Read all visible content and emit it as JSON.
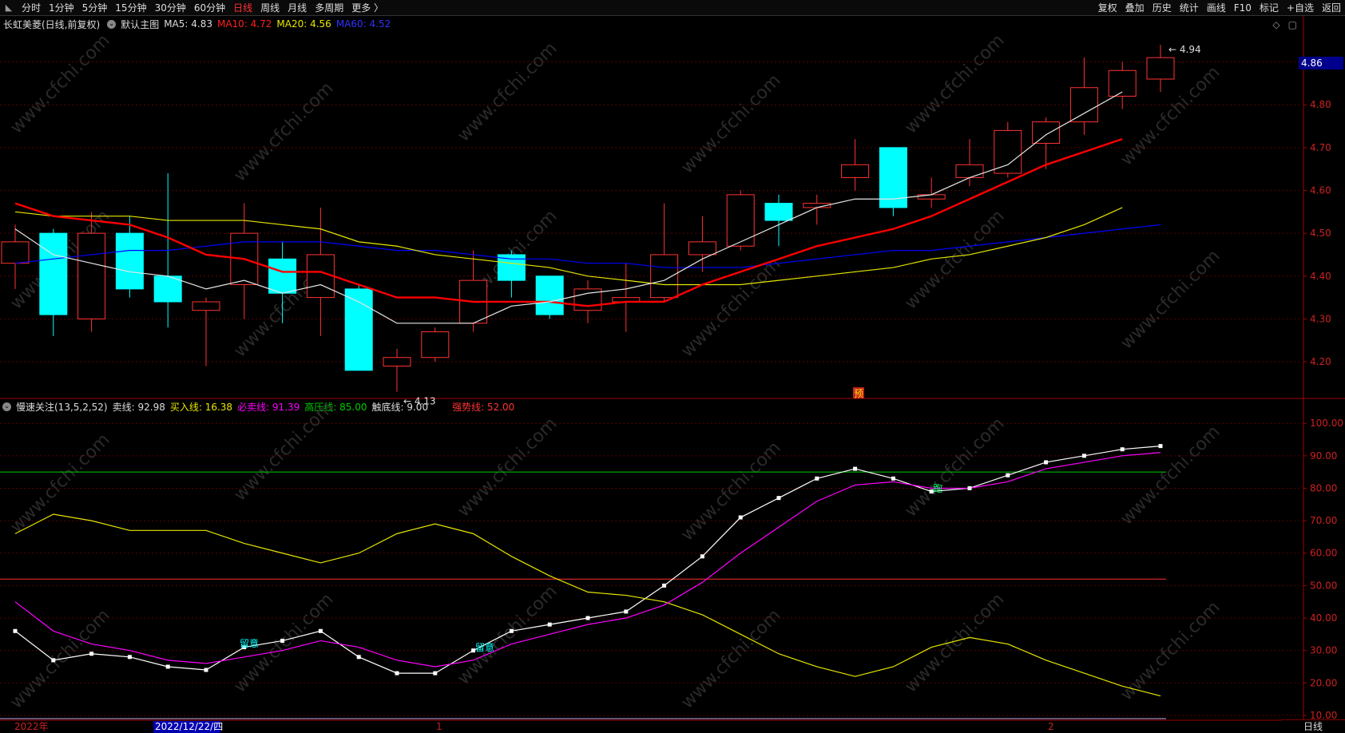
{
  "toolbar": {
    "left_items": [
      {
        "label": "分时",
        "active": false
      },
      {
        "label": "1分钟",
        "active": false
      },
      {
        "label": "5分钟",
        "active": false
      },
      {
        "label": "15分钟",
        "active": false
      },
      {
        "label": "30分钟",
        "active": false
      },
      {
        "label": "60分钟",
        "active": false
      },
      {
        "label": "日线",
        "active": true
      },
      {
        "label": "周线",
        "active": false
      },
      {
        "label": "月线",
        "active": false
      },
      {
        "label": "多周期",
        "active": false
      },
      {
        "label": "更多 〉",
        "active": false
      }
    ],
    "right_items": [
      "复权",
      "叠加",
      "历史",
      "统计",
      "画线",
      "F10",
      "标记",
      "+自选",
      "返回"
    ]
  },
  "main_info": {
    "stock_name": "长虹美菱(日线,前复权)",
    "template": "默认主图",
    "ma5": "MA5: 4.83",
    "ma10": "MA10: 4.72",
    "ma20": "MA20: 4.56",
    "ma60": "MA60: 4.52"
  },
  "indicator_info": {
    "name": "慢速关注(13,5,2,52)",
    "sell": "卖线: 92.98",
    "buy": "买入线: 16.38",
    "must_sell": "必卖线: 91.39",
    "high": "高压线: 85.00",
    "bottom": "触底线: 9.00",
    "strong": "强势线: 52.00"
  },
  "current_price": "4.86",
  "annotations": {
    "high_label": "4.94",
    "low_label": "4.13",
    "main_tag": "预",
    "ind_tags": [
      "留意",
      "留意",
      "跑"
    ]
  },
  "x_axis": {
    "labels": [
      "2022年",
      "2022/12/22/四",
      "1",
      "2"
    ]
  },
  "corner_label": "日线",
  "watermark": "www.cfchi.com",
  "colors": {
    "up": "#ff3232",
    "down": "#00ffff",
    "ma5": "#e6e6e6",
    "ma10": "#ff0000",
    "ma20": "#e6e600",
    "ma60": "#0000ff",
    "sell_line": "#ffffff",
    "buy_line": "#e6e600",
    "must_sell": "#ff00ff",
    "high_line": "#00cc00",
    "strong_line": "#ff3333",
    "axis": "#a00000"
  },
  "chart_data": [
    {
      "type": "candlestick",
      "title": "长虹美菱(日线,前复权)",
      "y_ticks": [
        4.2,
        4.3,
        4.4,
        4.5,
        4.6,
        4.7,
        4.8,
        4.9
      ],
      "ylim": [
        4.12,
        4.97
      ],
      "candles": [
        {
          "o": 4.43,
          "h": 4.52,
          "l": 4.37,
          "c": 4.48
        },
        {
          "o": 4.5,
          "h": 4.51,
          "l": 4.26,
          "c": 4.31
        },
        {
          "o": 4.3,
          "h": 4.55,
          "l": 4.27,
          "c": 4.5
        },
        {
          "o": 4.5,
          "h": 4.54,
          "l": 4.35,
          "c": 4.37
        },
        {
          "o": 4.4,
          "h": 4.64,
          "l": 4.28,
          "c": 4.34
        },
        {
          "o": 4.32,
          "h": 4.35,
          "l": 4.19,
          "c": 4.34
        },
        {
          "o": 4.38,
          "h": 4.57,
          "l": 4.3,
          "c": 4.5
        },
        {
          "o": 4.44,
          "h": 4.48,
          "l": 4.29,
          "c": 4.36
        },
        {
          "o": 4.35,
          "h": 4.56,
          "l": 4.26,
          "c": 4.45
        },
        {
          "o": 4.37,
          "h": 4.38,
          "l": 4.18,
          "c": 4.18
        },
        {
          "o": 4.19,
          "h": 4.23,
          "l": 4.13,
          "c": 4.21
        },
        {
          "o": 4.21,
          "h": 4.28,
          "l": 4.2,
          "c": 4.27
        },
        {
          "o": 4.29,
          "h": 4.46,
          "l": 4.27,
          "c": 4.39
        },
        {
          "o": 4.45,
          "h": 4.46,
          "l": 4.35,
          "c": 4.39
        },
        {
          "o": 4.4,
          "h": 4.4,
          "l": 4.3,
          "c": 4.31
        },
        {
          "o": 4.32,
          "h": 4.39,
          "l": 4.29,
          "c": 4.37
        },
        {
          "o": 4.34,
          "h": 4.43,
          "l": 4.27,
          "c": 4.35
        },
        {
          "o": 4.35,
          "h": 4.57,
          "l": 4.34,
          "c": 4.45
        },
        {
          "o": 4.45,
          "h": 4.54,
          "l": 4.41,
          "c": 4.48
        },
        {
          "o": 4.47,
          "h": 4.6,
          "l": 4.46,
          "c": 4.59
        },
        {
          "o": 4.57,
          "h": 4.59,
          "l": 4.47,
          "c": 4.53
        },
        {
          "o": 4.56,
          "h": 4.59,
          "l": 4.52,
          "c": 4.57
        },
        {
          "o": 4.63,
          "h": 4.72,
          "l": 4.6,
          "c": 4.66
        },
        {
          "o": 4.7,
          "h": 4.7,
          "l": 4.54,
          "c": 4.56
        },
        {
          "o": 4.58,
          "h": 4.63,
          "l": 4.56,
          "c": 4.59
        },
        {
          "o": 4.63,
          "h": 4.72,
          "l": 4.61,
          "c": 4.66
        },
        {
          "o": 4.64,
          "h": 4.76,
          "l": 4.63,
          "c": 4.74
        },
        {
          "o": 4.71,
          "h": 4.77,
          "l": 4.65,
          "c": 4.76
        },
        {
          "o": 4.76,
          "h": 4.91,
          "l": 4.73,
          "c": 4.84
        },
        {
          "o": 4.82,
          "h": 4.9,
          "l": 4.79,
          "c": 4.88
        },
        {
          "o": 4.86,
          "h": 4.94,
          "l": 4.83,
          "c": 4.91
        }
      ],
      "ma5": [
        4.51,
        4.45,
        4.43,
        4.41,
        4.4,
        4.37,
        4.39,
        4.36,
        4.38,
        4.34,
        4.29,
        4.29,
        4.29,
        4.33,
        4.34,
        4.36,
        4.37,
        4.39,
        4.44,
        4.48,
        4.52,
        4.56,
        4.58,
        4.58,
        4.59,
        4.63,
        4.66,
        4.73,
        4.78,
        4.83
      ],
      "ma10": [
        4.57,
        4.54,
        4.53,
        4.52,
        4.49,
        4.45,
        4.44,
        4.41,
        4.41,
        4.38,
        4.35,
        4.35,
        4.34,
        4.34,
        4.34,
        4.33,
        4.34,
        4.34,
        4.38,
        4.41,
        4.44,
        4.47,
        4.49,
        4.51,
        4.54,
        4.58,
        4.62,
        4.66,
        4.69,
        4.72
      ],
      "ma20": [
        4.55,
        4.54,
        4.54,
        4.54,
        4.53,
        4.53,
        4.53,
        4.52,
        4.51,
        4.48,
        4.47,
        4.45,
        4.44,
        4.43,
        4.42,
        4.4,
        4.39,
        4.38,
        4.38,
        4.38,
        4.39,
        4.4,
        4.41,
        4.42,
        4.44,
        4.45,
        4.47,
        4.49,
        4.52,
        4.56
      ],
      "ma60": [
        4.43,
        4.44,
        4.45,
        4.46,
        4.46,
        4.47,
        4.48,
        4.48,
        4.48,
        4.47,
        4.46,
        4.46,
        4.45,
        4.44,
        4.44,
        4.43,
        4.43,
        4.42,
        4.42,
        4.42,
        4.43,
        4.44,
        4.45,
        4.46,
        4.46,
        4.47,
        4.48,
        4.49,
        4.5,
        4.51,
        4.52
      ]
    },
    {
      "type": "line",
      "title": "慢速关注(13,5,2,52)",
      "y_ticks": [
        10,
        20,
        30,
        40,
        50,
        60,
        70,
        80,
        90,
        100
      ],
      "ylim": [
        9,
        103
      ],
      "series": [
        {
          "name": "卖线",
          "values": [
            36,
            27,
            29,
            28,
            25,
            24,
            31,
            33,
            36,
            28,
            23,
            23,
            30,
            36,
            38,
            40,
            42,
            50,
            59,
            71,
            77,
            83,
            86,
            83,
            79,
            80,
            84,
            88,
            90,
            92,
            93
          ]
        },
        {
          "name": "买入线",
          "values": [
            66,
            72,
            70,
            67,
            67,
            67,
            63,
            60,
            57,
            60,
            66,
            69,
            66,
            59,
            53,
            48,
            47,
            45,
            41,
            35,
            29,
            25,
            22,
            25,
            31,
            34,
            32,
            27,
            23,
            19,
            16
          ]
        },
        {
          "name": "必卖线",
          "values": [
            45,
            36,
            32,
            30,
            27,
            26,
            28,
            30,
            33,
            31,
            27,
            25,
            27,
            32,
            35,
            38,
            40,
            44,
            51,
            60,
            68,
            76,
            81,
            82,
            80,
            80,
            82,
            86,
            88,
            90,
            91
          ]
        }
      ],
      "levels": {
        "high_line": 85,
        "strong_line": 52,
        "bottom_line": 9
      }
    }
  ]
}
